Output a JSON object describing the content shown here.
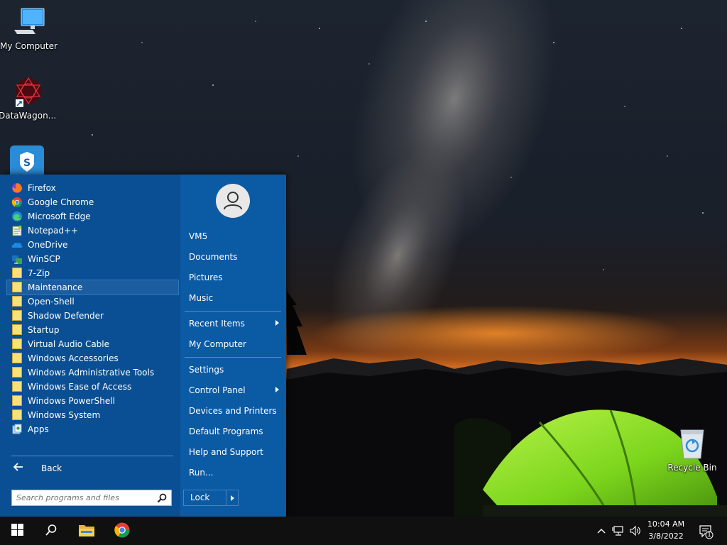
{
  "desktop": {
    "icons": [
      {
        "label": "My Computer"
      },
      {
        "label": "DataWagon..."
      },
      {
        "label": "Recycle Bin"
      }
    ]
  },
  "start_menu": {
    "programs": [
      {
        "label": "Firefox",
        "icon": "firefox-icon"
      },
      {
        "label": "Google Chrome",
        "icon": "chrome-icon"
      },
      {
        "label": "Microsoft Edge",
        "icon": "edge-icon"
      },
      {
        "label": "Notepad++",
        "icon": "notepadpp-icon"
      },
      {
        "label": "OneDrive",
        "icon": "onedrive-icon"
      },
      {
        "label": "WinSCP",
        "icon": "winscp-icon"
      },
      {
        "label": "7-Zip",
        "icon": "folder-icon"
      },
      {
        "label": "Maintenance",
        "icon": "folder-icon",
        "highlighted": true
      },
      {
        "label": "Open-Shell",
        "icon": "folder-icon"
      },
      {
        "label": "Shadow Defender",
        "icon": "folder-icon"
      },
      {
        "label": "Startup",
        "icon": "folder-icon"
      },
      {
        "label": "Virtual Audio Cable",
        "icon": "folder-icon"
      },
      {
        "label": "Windows Accessories",
        "icon": "folder-icon"
      },
      {
        "label": "Windows Administrative Tools",
        "icon": "folder-icon"
      },
      {
        "label": "Windows Ease of Access",
        "icon": "folder-icon"
      },
      {
        "label": "Windows PowerShell",
        "icon": "folder-icon"
      },
      {
        "label": "Windows System",
        "icon": "folder-icon"
      },
      {
        "label": "Apps",
        "icon": "apps-icon"
      }
    ],
    "back_label": "Back",
    "search_placeholder": "Search programs and files",
    "right_items": [
      {
        "label": "VM5"
      },
      {
        "label": "Documents"
      },
      {
        "label": "Pictures"
      },
      {
        "label": "Music"
      },
      {
        "label": "Recent Items",
        "submenu": true
      },
      {
        "label": "My Computer"
      },
      {
        "label": "Settings"
      },
      {
        "label": "Control Panel",
        "submenu": true
      },
      {
        "label": "Devices and Printers"
      },
      {
        "label": "Default Programs"
      },
      {
        "label": "Help and Support"
      },
      {
        "label": "Run..."
      }
    ],
    "lock_label": "Lock",
    "accent": "#0a4f93"
  },
  "taskbar": {
    "time": "10:04 AM",
    "date": "3/8/2022",
    "notification_count": "1"
  }
}
